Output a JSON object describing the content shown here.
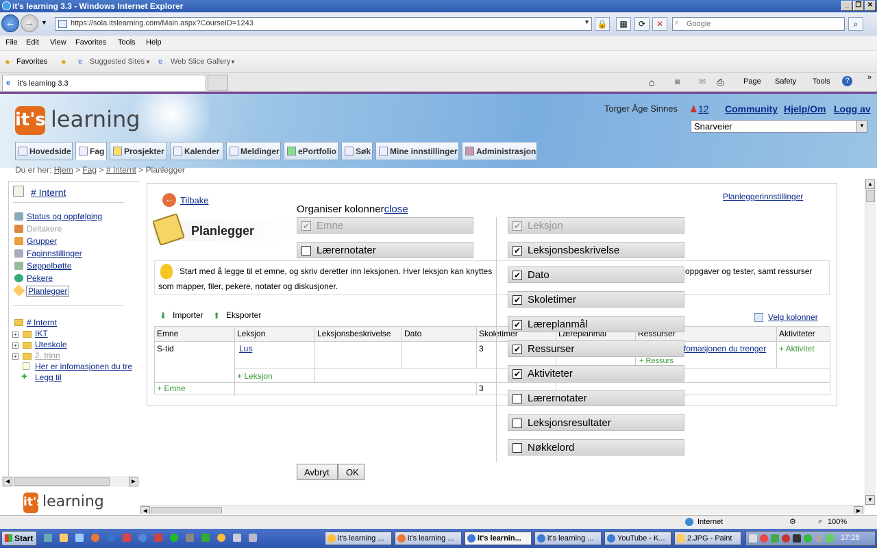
{
  "window": {
    "title": "it's learning 3.3 - Windows Internet Explorer"
  },
  "browser": {
    "url": "https://sola.itslearning.com/Main.aspx?CourseID=1243",
    "search_placeholder": "Google",
    "menu": [
      "File",
      "Edit",
      "View",
      "Favorites",
      "Tools",
      "Help"
    ],
    "favorites": {
      "label": "Favorites",
      "suggested": "Suggested Sites",
      "webslice": "Web Slice Gallery"
    },
    "tab_title": "it's learning 3.3",
    "commands": {
      "page": "Page",
      "safety": "Safety",
      "tools": "Tools"
    }
  },
  "header": {
    "logo_its": "it's",
    "logo_learning": "learning",
    "user_name": "Torger Åge Sinnes",
    "notifications": "12",
    "community": "Community",
    "help": "Hjelp/Om",
    "logout": "Logg av",
    "shortcuts": "Snarveier"
  },
  "nav_tabs": [
    "Hovedside",
    "Fag",
    "Prosjekter",
    "Kalender",
    "Meldinger",
    "ePortfolio",
    "Søk",
    "Mine innstillinger",
    "Administrasjon"
  ],
  "breadcrumb": {
    "prefix": "Du er her:",
    "items": [
      "Hjem",
      "Fag",
      "# Internt"
    ],
    "current": "Planlegger",
    "sep": ">"
  },
  "leftnav": {
    "course": "# Internt",
    "items": [
      "Status og oppfølging",
      "Deltakere",
      "Grupper",
      "Faginnstillinger",
      "Søppelbøtte",
      "Pekere",
      "Planlegger"
    ],
    "tree": [
      "# Internt",
      "IKT",
      "Uteskole",
      "2. trinn",
      "Her er infomasjonen du tre",
      "Legg til"
    ],
    "footer_logo_its": "it's",
    "footer_logo_learning": "learning"
  },
  "planner": {
    "back": "Tilbake",
    "settings_link": "Planleggerinnstillinger",
    "title": "Planlegger",
    "info": "Start med å legge til et emne, og skriv deretter inn leksjonen. Hver leksjon kan knyttes",
    "info_tail": "oppgaver og tester, samt ressurser",
    "info_line2": "som mapper, filer, pekere, notater og diskusjoner.",
    "import": "Importer",
    "export": "Eksporter",
    "choose_columns": "Velg kolonner",
    "columns": [
      "Emne",
      "Leksjon",
      "Leksjonsbeskrivelse",
      "Dato",
      "Skoletimer",
      "Læreplanmål",
      "Ressurser",
      "Aktiviteter"
    ],
    "row": {
      "emne": "S-tid",
      "leksjon": "Lus",
      "skoletimer": "3",
      "ressurs_link": "fomasjonen du trenger",
      "add_activity": "+ Aktivitet",
      "add_resource": "+ Ressurs"
    },
    "add_lesson": "+ Leksjon",
    "add_topic": "+ Emne",
    "total_hours": "3"
  },
  "organize": {
    "title": "Organiser kolonner",
    "close": "close",
    "left": [
      {
        "label": "Emne",
        "checked": true,
        "disabled": true
      },
      {
        "label": "Lærernotater",
        "checked": false,
        "disabled": false
      }
    ],
    "right": [
      {
        "label": "Leksjon",
        "checked": true,
        "disabled": true
      },
      {
        "label": "Leksjonsbeskrivelse",
        "checked": true,
        "disabled": false
      },
      {
        "label": "Dato",
        "checked": true,
        "disabled": false
      },
      {
        "label": "Skoletimer",
        "checked": true,
        "disabled": false
      },
      {
        "label": "Læreplanmål",
        "checked": true,
        "disabled": false
      },
      {
        "label": "Ressurser",
        "checked": true,
        "disabled": false
      },
      {
        "label": "Aktiviteter",
        "checked": true,
        "disabled": false
      },
      {
        "label": "Lærernotater",
        "checked": false,
        "disabled": false
      },
      {
        "label": "Leksjonsresultater",
        "checked": false,
        "disabled": false
      },
      {
        "label": "Nøkkelord",
        "checked": false,
        "disabled": false
      }
    ],
    "cancel": "Avbryt",
    "ok": "OK"
  },
  "statusbar": {
    "zone": "Internet",
    "zoom": "100%"
  },
  "taskbar": {
    "start": "Start",
    "tasks": [
      "it's learning ...",
      "it's learning ...",
      "it's learnin...",
      "it's learning ...",
      "YouTube - K...",
      "2.JPG - Paint"
    ],
    "clock": "17:28"
  }
}
